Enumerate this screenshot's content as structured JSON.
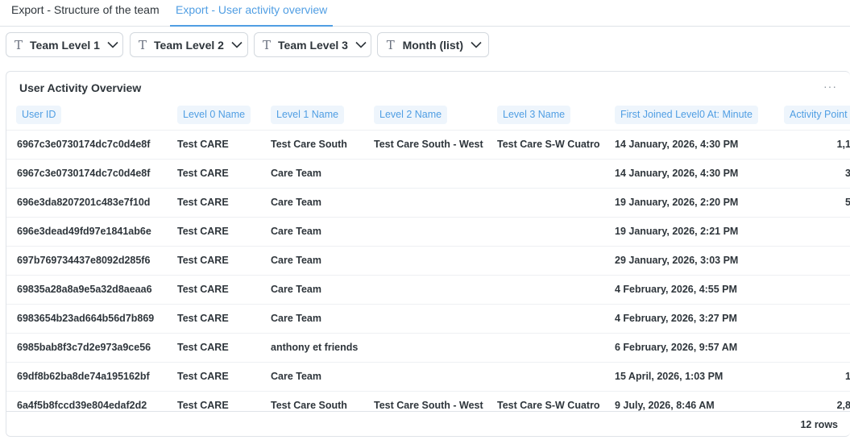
{
  "tabs": [
    {
      "label": "Export - Structure of the team",
      "active": false
    },
    {
      "label": "Export - User activity overview",
      "active": true
    }
  ],
  "filters": [
    {
      "label": "Team Level 1",
      "icon": "text-type-icon"
    },
    {
      "label": "Team Level 2",
      "icon": "text-type-icon"
    },
    {
      "label": "Team Level 3",
      "icon": "text-type-icon"
    },
    {
      "label": "Month (list)",
      "icon": "text-type-icon"
    }
  ],
  "card": {
    "title": "User Activity Overview",
    "more_label": "···",
    "footer": "12 rows"
  },
  "columns": [
    "User ID",
    "Level 0 Name",
    "Level 1 Name",
    "Level 2 Name",
    "Level 3 Name",
    "First Joined Level0 At: Minute",
    "Activity Point"
  ],
  "rows": [
    [
      "6967c3e0730174dc7c0d4e8f",
      "Test CARE",
      "Test Care South",
      "Test Care South - West",
      "Test Care S-W Cuatro",
      "14 January, 2026, 4:30 PM",
      "1,1"
    ],
    [
      "6967c3e0730174dc7c0d4e8f",
      "Test CARE",
      "Care Team",
      "",
      "",
      "14 January, 2026, 4:30 PM",
      "3"
    ],
    [
      "696e3da8207201c483e7f10d",
      "Test CARE",
      "Care Team",
      "",
      "",
      "19 January, 2026, 2:20 PM",
      "5"
    ],
    [
      "696e3dead49fd97e1841ab6e",
      "Test CARE",
      "Care Team",
      "",
      "",
      "19 January, 2026, 2:21 PM",
      ""
    ],
    [
      "697b769734437e8092d285f6",
      "Test CARE",
      "Care Team",
      "",
      "",
      "29 January, 2026, 3:03 PM",
      ""
    ],
    [
      "69835a28a8a9e5a32d8aeaa6",
      "Test CARE",
      "Care Team",
      "",
      "",
      "4 February, 2026, 4:55 PM",
      ""
    ],
    [
      "6983654b23ad664b56d7b869",
      "Test CARE",
      "Care Team",
      "",
      "",
      "4 February, 2026, 3:27 PM",
      ""
    ],
    [
      "6985bab8f3c7d2e973a9ce56",
      "Test CARE",
      "anthony et friends",
      "",
      "",
      "6 February, 2026, 9:57 AM",
      ""
    ],
    [
      "69df8b62ba8de74a195162bf",
      "Test CARE",
      "Care Team",
      "",
      "",
      "15 April, 2026, 1:03 PM",
      "1"
    ],
    [
      "6a4f5b8fccd39e804edaf2d2",
      "Test CARE",
      "Test Care South",
      "Test Care South - West",
      "Test Care S-W Cuatro",
      "9 July, 2026, 8:46 AM",
      "2,8"
    ]
  ]
}
